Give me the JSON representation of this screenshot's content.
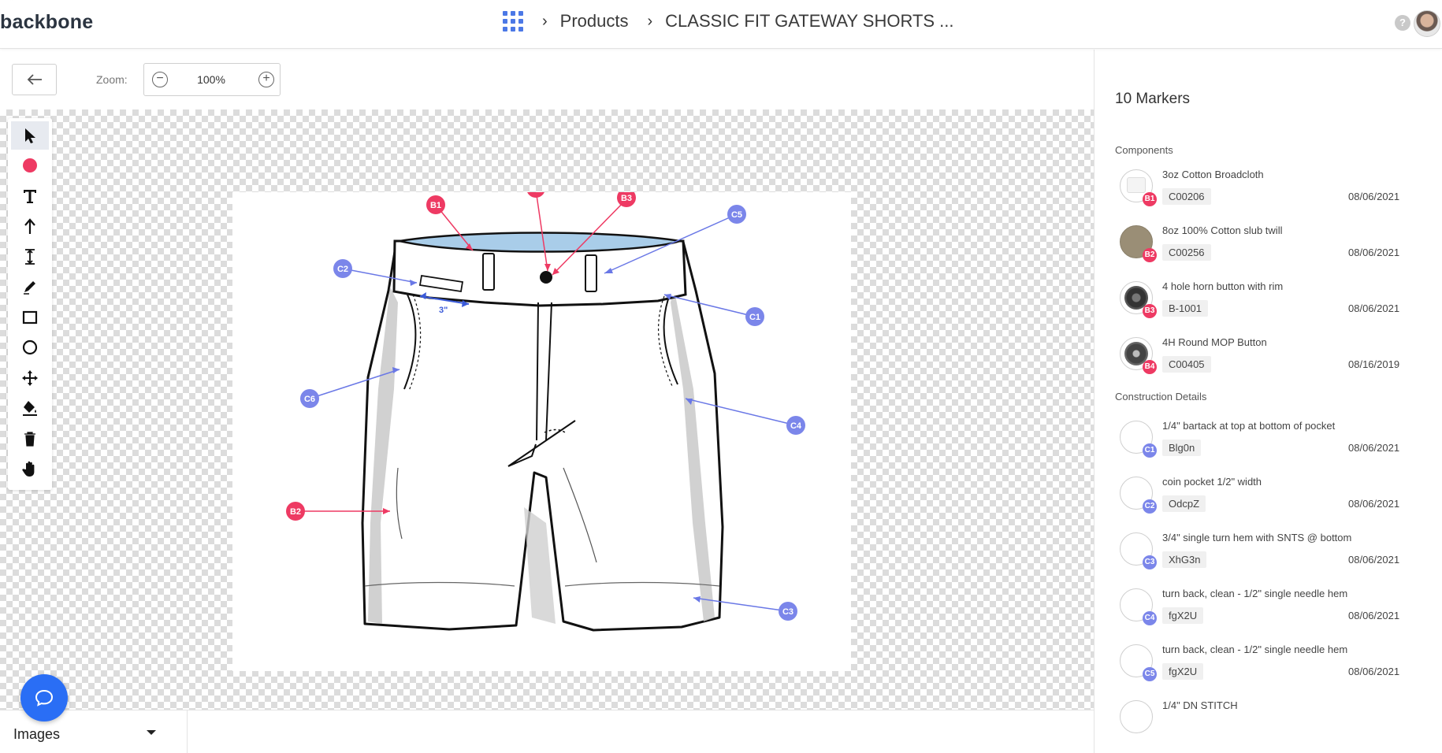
{
  "header": {
    "logo": "backbone",
    "breadcrumb": [
      "Products",
      "CLASSIC FIT GATEWAY SHORTS ..."
    ],
    "help_label": "?"
  },
  "toolbar": {
    "zoom_label": "Zoom:",
    "zoom_value": "100%",
    "back_icon": "arrow-left-icon"
  },
  "tools": [
    {
      "name": "select",
      "icon": "cursor-arrow-icon",
      "active": true
    },
    {
      "name": "marker",
      "icon": "red-dot-icon",
      "active": false
    },
    {
      "name": "text",
      "icon": "text-icon",
      "active": false
    },
    {
      "name": "arrow",
      "icon": "arrow-up-icon",
      "active": false
    },
    {
      "name": "dimension",
      "icon": "measure-icon",
      "active": false
    },
    {
      "name": "pencil",
      "icon": "pencil-icon",
      "active": false
    },
    {
      "name": "rectangle",
      "icon": "rectangle-icon",
      "active": false
    },
    {
      "name": "circle",
      "icon": "circle-icon",
      "active": false
    },
    {
      "name": "move",
      "icon": "move-icon",
      "active": false
    },
    {
      "name": "fill",
      "icon": "paint-bucket-icon",
      "active": false
    },
    {
      "name": "delete",
      "icon": "trash-icon",
      "active": false
    },
    {
      "name": "pan",
      "icon": "hand-icon",
      "active": false
    }
  ],
  "annotations": {
    "b1": "B1",
    "b2": "B2",
    "b3": "B3",
    "b4": "B4",
    "c1": "C1",
    "c2": "C2",
    "c3": "C3",
    "c4": "C4",
    "c5": "C5",
    "c6": "C6",
    "dimension": "3\""
  },
  "colors": {
    "component_marker": "#ee3a63",
    "construction_marker": "#7b86ea",
    "accent": "#2a6ef5"
  },
  "bottom": {
    "images_label": "Images"
  },
  "panel": {
    "title": "10 Markers",
    "components_label": "Components",
    "construction_label": "Construction Details",
    "components": [
      {
        "badge": "B1",
        "name": "3oz Cotton Broadcloth",
        "code": "C00206",
        "date": "08/06/2021"
      },
      {
        "badge": "B2",
        "name": "8oz 100% Cotton slub twill",
        "code": "C00256",
        "date": "08/06/2021"
      },
      {
        "badge": "B3",
        "name": "4 hole horn button with rim",
        "code": "B-1001",
        "date": "08/06/2021"
      },
      {
        "badge": "B4",
        "name": "4H Round MOP Button",
        "code": "C00405",
        "date": "08/16/2019"
      }
    ],
    "construction": [
      {
        "badge": "C1",
        "name": "1/4\" bartack at top at bottom of pocket",
        "code": "Blg0n",
        "date": "08/06/2021"
      },
      {
        "badge": "C2",
        "name": "coin pocket 1/2\" width",
        "code": "OdcpZ",
        "date": "08/06/2021"
      },
      {
        "badge": "C3",
        "name": "3/4\" single turn hem with SNTS @ bottom",
        "code": "XhG3n",
        "date": "08/06/2021"
      },
      {
        "badge": "C4",
        "name": "turn back, clean - 1/2\" single needle hem",
        "code": "fgX2U",
        "date": "08/06/2021"
      },
      {
        "badge": "C5",
        "name": "turn back, clean - 1/2\" single needle hem",
        "code": "fgX2U",
        "date": "08/06/2021"
      },
      {
        "badge": "C6",
        "name": "1/4\" DN STITCH",
        "code": "",
        "date": ""
      }
    ]
  }
}
